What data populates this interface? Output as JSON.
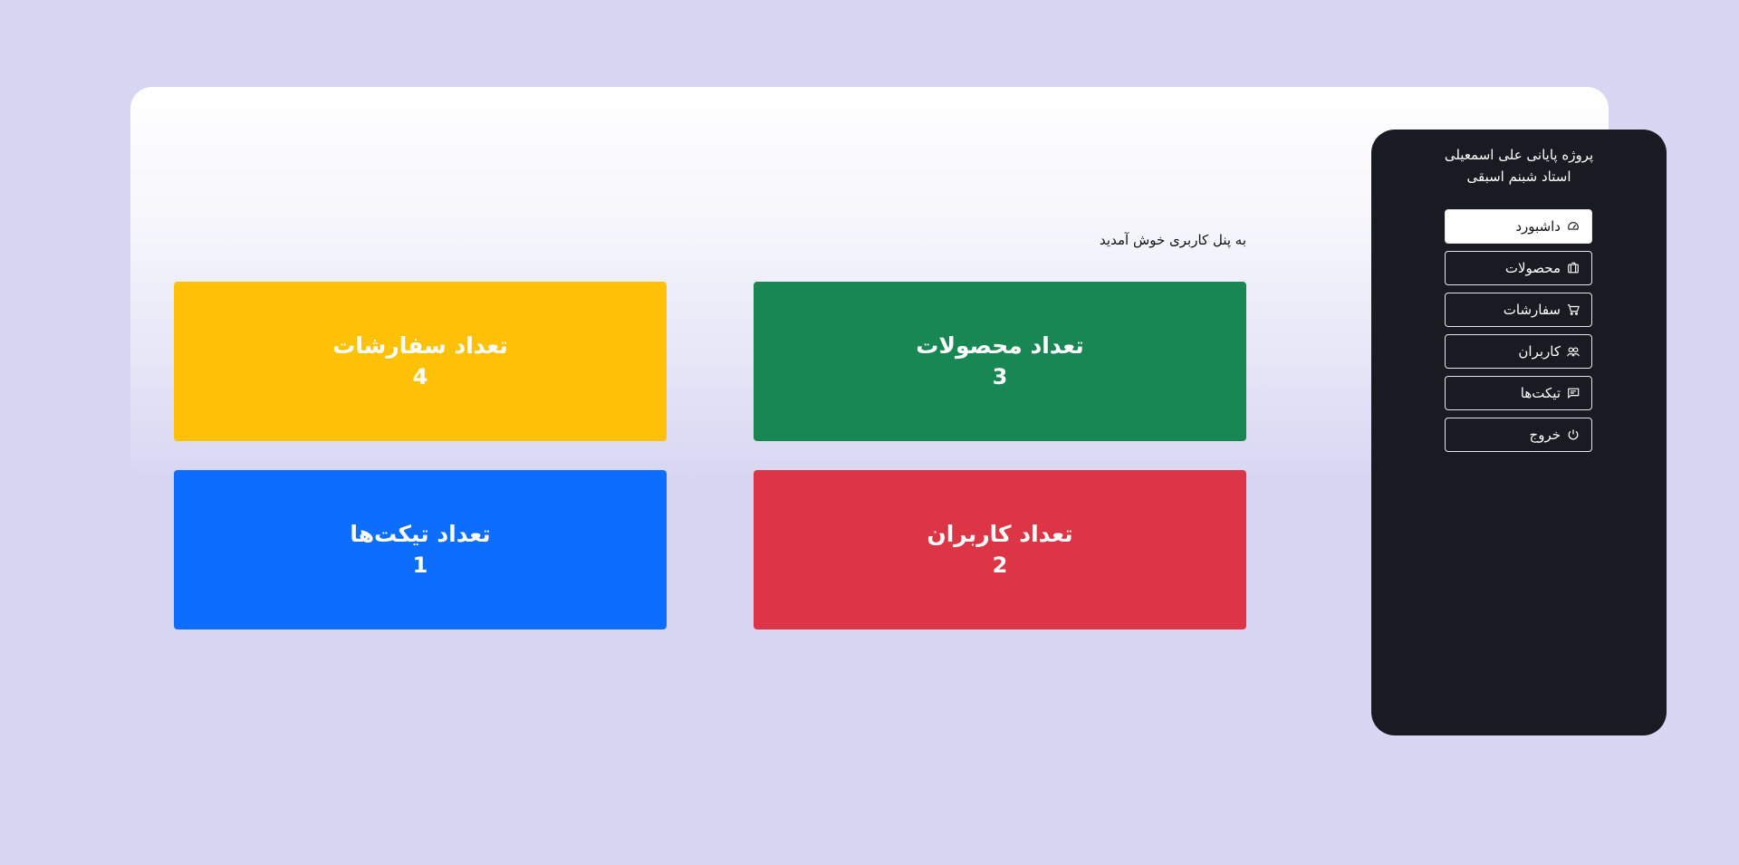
{
  "sidebar": {
    "title_line1": "پروژه پایانی علی اسمعیلی",
    "title_line2": "استاد شبنم اسبقی",
    "items": [
      {
        "label": "داشبورد",
        "icon": "speedometer-icon",
        "active": true
      },
      {
        "label": "محصولات",
        "icon": "box-icon"
      },
      {
        "label": "سفارشات",
        "icon": "cart-icon"
      },
      {
        "label": "کاربران",
        "icon": "users-icon"
      },
      {
        "label": "تیکت‌ها",
        "icon": "chat-icon"
      },
      {
        "label": "خروج",
        "icon": "power-icon"
      }
    ]
  },
  "main": {
    "welcome": "به پنل کاربری خوش آمدید",
    "cards": {
      "products": {
        "label": "تعداد محصولات",
        "count": "3",
        "color": "#198754"
      },
      "orders": {
        "label": "تعداد سفارشات",
        "count": "4",
        "color": "#ffc107"
      },
      "users": {
        "label": "تعداد کاربران",
        "count": "2",
        "color": "#dc3545"
      },
      "tickets": {
        "label": "تعداد تیکت‌ها",
        "count": "1",
        "color": "#0d6efd"
      }
    }
  }
}
